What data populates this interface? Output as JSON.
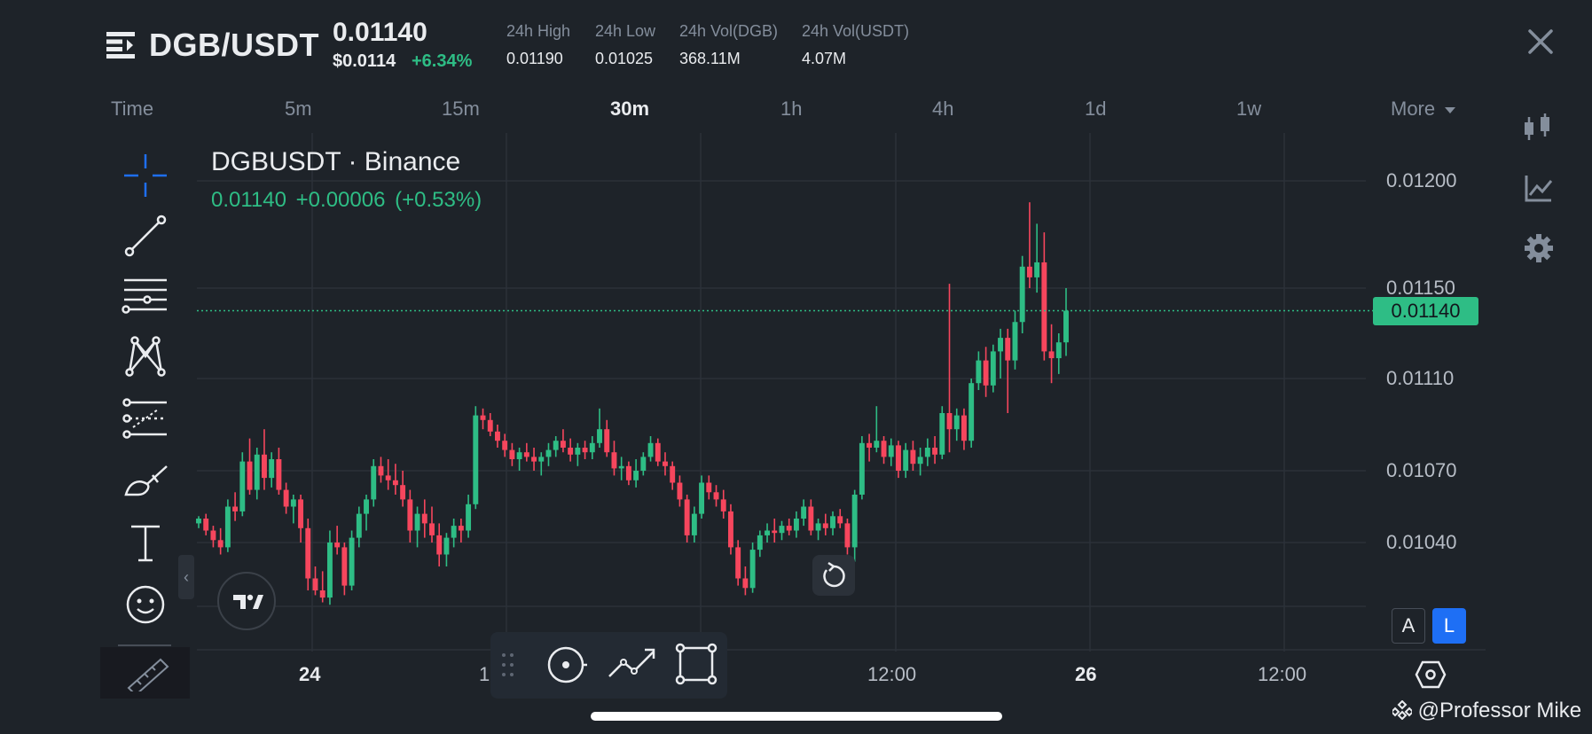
{
  "header": {
    "pair": "DGB/USDT",
    "last_price": "0.01140",
    "usd_price": "$0.0114",
    "change_pct": "+6.34%",
    "stats": [
      {
        "label": "24h High",
        "value": "0.01190"
      },
      {
        "label": "24h Low",
        "value": "0.01025"
      },
      {
        "label": "24h Vol(DGB)",
        "value": "368.11M"
      },
      {
        "label": "24h Vol(USDT)",
        "value": "4.07M"
      }
    ]
  },
  "timeframes": {
    "time_label": "Time",
    "items": [
      "5m",
      "15m",
      "30m",
      "1h",
      "4h",
      "1d",
      "1w"
    ],
    "active": "30m",
    "more_label": "More"
  },
  "chart": {
    "symbol_title": "DGBUSDT · Binance",
    "last": "0.01140",
    "change": "+0.00006",
    "change_pct": "(+0.53%)",
    "current_price_tag": "0.01140",
    "price_ticks": [
      "0.01200",
      "0.01150",
      "0.01110",
      "0.01070",
      "0.01040"
    ],
    "time_ticks": [
      {
        "label": "24",
        "bold": true
      },
      {
        "label": "1",
        "bold": false
      },
      {
        "label": "12:00",
        "bold": false
      },
      {
        "label": "26",
        "bold": true
      },
      {
        "label": "12:00",
        "bold": false
      }
    ]
  },
  "chart_data": {
    "type": "candlestick",
    "title": "DGBUSDT · Binance",
    "timeframe": "30m",
    "ylim": [
      0.0101,
      0.01225
    ],
    "y_ticks": [
      0.0104,
      0.0107,
      0.0111,
      0.0115,
      0.012
    ],
    "x_ticks": [
      "24",
      "1",
      "12:00",
      "26",
      "12:00"
    ],
    "current_price": 0.0114,
    "grid": true,
    "candles": [
      [
        0.01048,
        0.01051,
        0.01046,
        0.0105
      ],
      [
        0.0105,
        0.01052,
        0.01043,
        0.01045
      ],
      [
        0.01045,
        0.01047,
        0.01038,
        0.01041
      ],
      [
        0.01041,
        0.01046,
        0.01035,
        0.01038
      ],
      [
        0.01038,
        0.01058,
        0.01036,
        0.01055
      ],
      [
        0.01055,
        0.01061,
        0.01049,
        0.01053
      ],
      [
        0.01053,
        0.01078,
        0.01051,
        0.01074
      ],
      [
        0.01074,
        0.01084,
        0.0106,
        0.01062
      ],
      [
        0.01062,
        0.0108,
        0.01058,
        0.01077
      ],
      [
        0.01077,
        0.01088,
        0.01062,
        0.01067
      ],
      [
        0.01067,
        0.01078,
        0.01063,
        0.01075
      ],
      [
        0.01075,
        0.0108,
        0.0106,
        0.01062
      ],
      [
        0.01062,
        0.01065,
        0.01052,
        0.01055
      ],
      [
        0.01055,
        0.0106,
        0.01048,
        0.01058
      ],
      [
        0.01058,
        0.0106,
        0.0104,
        0.01046
      ],
      [
        0.01046,
        0.0105,
        0.0102,
        0.01025
      ],
      [
        0.01025,
        0.0103,
        0.01018,
        0.0102
      ],
      [
        0.0102,
        0.01028,
        0.01015,
        0.01017
      ],
      [
        0.01017,
        0.01045,
        0.01014,
        0.0104
      ],
      [
        0.0104,
        0.01047,
        0.01035,
        0.01038
      ],
      [
        0.01038,
        0.0104,
        0.01018,
        0.01022
      ],
      [
        0.01022,
        0.01045,
        0.0102,
        0.01042
      ],
      [
        0.01042,
        0.01055,
        0.01038,
        0.01052
      ],
      [
        0.01052,
        0.0106,
        0.01045,
        0.01058
      ],
      [
        0.01058,
        0.01075,
        0.01055,
        0.01072
      ],
      [
        0.01072,
        0.01076,
        0.01065,
        0.01068
      ],
      [
        0.01068,
        0.01075,
        0.01062,
        0.01066
      ],
      [
        0.01066,
        0.01073,
        0.0106,
        0.01064
      ],
      [
        0.01064,
        0.0107,
        0.01055,
        0.01058
      ],
      [
        0.01058,
        0.01062,
        0.0104,
        0.01045
      ],
      [
        0.01045,
        0.01055,
        0.01038,
        0.01052
      ],
      [
        0.01052,
        0.01058,
        0.01042,
        0.01048
      ],
      [
        0.01048,
        0.01055,
        0.0104,
        0.01043
      ],
      [
        0.01043,
        0.01048,
        0.0103,
        0.01035
      ],
      [
        0.01035,
        0.01044,
        0.0103,
        0.01042
      ],
      [
        0.01042,
        0.0105,
        0.01038,
        0.01047
      ],
      [
        0.01047,
        0.0105,
        0.0104,
        0.01045
      ],
      [
        0.01045,
        0.0106,
        0.01042,
        0.01056
      ],
      [
        0.01056,
        0.01098,
        0.01054,
        0.01094
      ],
      [
        0.01094,
        0.01097,
        0.01088,
        0.01092
      ],
      [
        0.01092,
        0.01095,
        0.01085,
        0.01087
      ],
      [
        0.01087,
        0.0109,
        0.0108,
        0.01083
      ],
      [
        0.01083,
        0.01086,
        0.01076,
        0.01079
      ],
      [
        0.01079,
        0.01082,
        0.01072,
        0.01075
      ],
      [
        0.01075,
        0.0108,
        0.0107,
        0.01078
      ],
      [
        0.01078,
        0.01082,
        0.01074,
        0.01076
      ],
      [
        0.01076,
        0.0108,
        0.0107,
        0.01074
      ],
      [
        0.01074,
        0.01078,
        0.01068,
        0.01076
      ],
      [
        0.01076,
        0.01082,
        0.01072,
        0.01079
      ],
      [
        0.01079,
        0.01085,
        0.01076,
        0.01083
      ],
      [
        0.01083,
        0.01088,
        0.01078,
        0.0108
      ],
      [
        0.0108,
        0.01084,
        0.01074,
        0.01077
      ],
      [
        0.01077,
        0.01082,
        0.01072,
        0.0108
      ],
      [
        0.0108,
        0.01083,
        0.01075,
        0.01078
      ],
      [
        0.01078,
        0.01085,
        0.01075,
        0.01082
      ],
      [
        0.01082,
        0.01097,
        0.0108,
        0.01088
      ],
      [
        0.01088,
        0.01092,
        0.01076,
        0.01078
      ],
      [
        0.01078,
        0.01083,
        0.01068,
        0.01071
      ],
      [
        0.01071,
        0.01076,
        0.01066,
        0.01072
      ],
      [
        0.01072,
        0.01074,
        0.01064,
        0.01066
      ],
      [
        0.01066,
        0.01075,
        0.01063,
        0.0107
      ],
      [
        0.0107,
        0.01078,
        0.01068,
        0.01076
      ],
      [
        0.01076,
        0.01085,
        0.01074,
        0.01082
      ],
      [
        0.01082,
        0.01084,
        0.01072,
        0.01074
      ],
      [
        0.01074,
        0.01078,
        0.01068,
        0.01072
      ],
      [
        0.01072,
        0.01074,
        0.01062,
        0.01065
      ],
      [
        0.01065,
        0.01068,
        0.01055,
        0.01058
      ],
      [
        0.01058,
        0.0106,
        0.0104,
        0.01043
      ],
      [
        0.01043,
        0.01055,
        0.0104,
        0.01052
      ],
      [
        0.01052,
        0.01068,
        0.0105,
        0.01065
      ],
      [
        0.01065,
        0.01068,
        0.01058,
        0.01061
      ],
      [
        0.01061,
        0.01064,
        0.01055,
        0.01058
      ],
      [
        0.01058,
        0.01062,
        0.0105,
        0.01053
      ],
      [
        0.01053,
        0.01056,
        0.01035,
        0.01038
      ],
      [
        0.01038,
        0.01041,
        0.01022,
        0.01025
      ],
      [
        0.01025,
        0.0103,
        0.01018,
        0.01021
      ],
      [
        0.01021,
        0.0104,
        0.01019,
        0.01037
      ],
      [
        0.01037,
        0.01045,
        0.01034,
        0.01043
      ],
      [
        0.01043,
        0.01048,
        0.0104,
        0.01045
      ],
      [
        0.01045,
        0.0105,
        0.0104,
        0.01044
      ],
      [
        0.01044,
        0.01049,
        0.01041,
        0.01047
      ],
      [
        0.01047,
        0.0105,
        0.01043,
        0.01045
      ],
      [
        0.01045,
        0.01053,
        0.01042,
        0.0105
      ],
      [
        0.0105,
        0.01058,
        0.01047,
        0.01055
      ],
      [
        0.01055,
        0.01058,
        0.01043,
        0.01045
      ],
      [
        0.01045,
        0.0105,
        0.01041,
        0.01048
      ],
      [
        0.01048,
        0.01052,
        0.01043,
        0.01046
      ],
      [
        0.01046,
        0.01053,
        0.01043,
        0.01051
      ],
      [
        0.01051,
        0.01054,
        0.01046,
        0.01048
      ],
      [
        0.01048,
        0.0105,
        0.01035,
        0.01038
      ],
      [
        0.01038,
        0.01062,
        0.01032,
        0.0106
      ],
      [
        0.0106,
        0.01085,
        0.01058,
        0.01082
      ],
      [
        0.01082,
        0.01086,
        0.01074,
        0.0108
      ],
      [
        0.0108,
        0.01098,
        0.01078,
        0.01083
      ],
      [
        0.01083,
        0.01085,
        0.01073,
        0.01076
      ],
      [
        0.01076,
        0.01084,
        0.01072,
        0.01081
      ],
      [
        0.01081,
        0.01083,
        0.01067,
        0.0107
      ],
      [
        0.0107,
        0.01082,
        0.01067,
        0.01079
      ],
      [
        0.01079,
        0.01083,
        0.0107,
        0.01073
      ],
      [
        0.01073,
        0.0108,
        0.01068,
        0.01076
      ],
      [
        0.01076,
        0.01084,
        0.01072,
        0.0108
      ],
      [
        0.0108,
        0.01085,
        0.01073,
        0.01077
      ],
      [
        0.01077,
        0.01098,
        0.01075,
        0.01095
      ],
      [
        0.01095,
        0.01152,
        0.01078,
        0.01088
      ],
      [
        0.01088,
        0.01097,
        0.01083,
        0.01094
      ],
      [
        0.01094,
        0.01097,
        0.01079,
        0.01083
      ],
      [
        0.01083,
        0.0111,
        0.0108,
        0.01108
      ],
      [
        0.01108,
        0.01122,
        0.01105,
        0.01118
      ],
      [
        0.01118,
        0.01124,
        0.01102,
        0.01107
      ],
      [
        0.01107,
        0.01125,
        0.01104,
        0.01122
      ],
      [
        0.01122,
        0.01132,
        0.0111,
        0.01128
      ],
      [
        0.01128,
        0.01132,
        0.01095,
        0.01118
      ],
      [
        0.01118,
        0.0114,
        0.01114,
        0.01135
      ],
      [
        0.01135,
        0.01165,
        0.0113,
        0.0116
      ],
      [
        0.0116,
        0.0119,
        0.0115,
        0.01155
      ],
      [
        0.01155,
        0.0118,
        0.01148,
        0.01162
      ],
      [
        0.01162,
        0.01176,
        0.01118,
        0.01122
      ],
      [
        0.01122,
        0.01134,
        0.01108,
        0.01119
      ],
      [
        0.01119,
        0.0113,
        0.01112,
        0.01126
      ],
      [
        0.01126,
        0.0115,
        0.0112,
        0.0114
      ]
    ]
  },
  "float_toolbar": {
    "items": [
      "drag-handle",
      "magnet",
      "trend",
      "rectangle"
    ]
  },
  "side_tools": [
    "crosshair",
    "trendline",
    "horizontal-lines",
    "pattern",
    "fib",
    "brush",
    "text",
    "emoji",
    "ruler"
  ],
  "right_controls": [
    "candlestick-type",
    "indicators",
    "settings"
  ],
  "auto_label": "A",
  "log_label": "L",
  "watermark": "@Professor Mike",
  "colors": {
    "up": "#2ebd85",
    "down": "#f6465d",
    "background": "#1e2329",
    "active_tool": "#1e6ff5"
  }
}
